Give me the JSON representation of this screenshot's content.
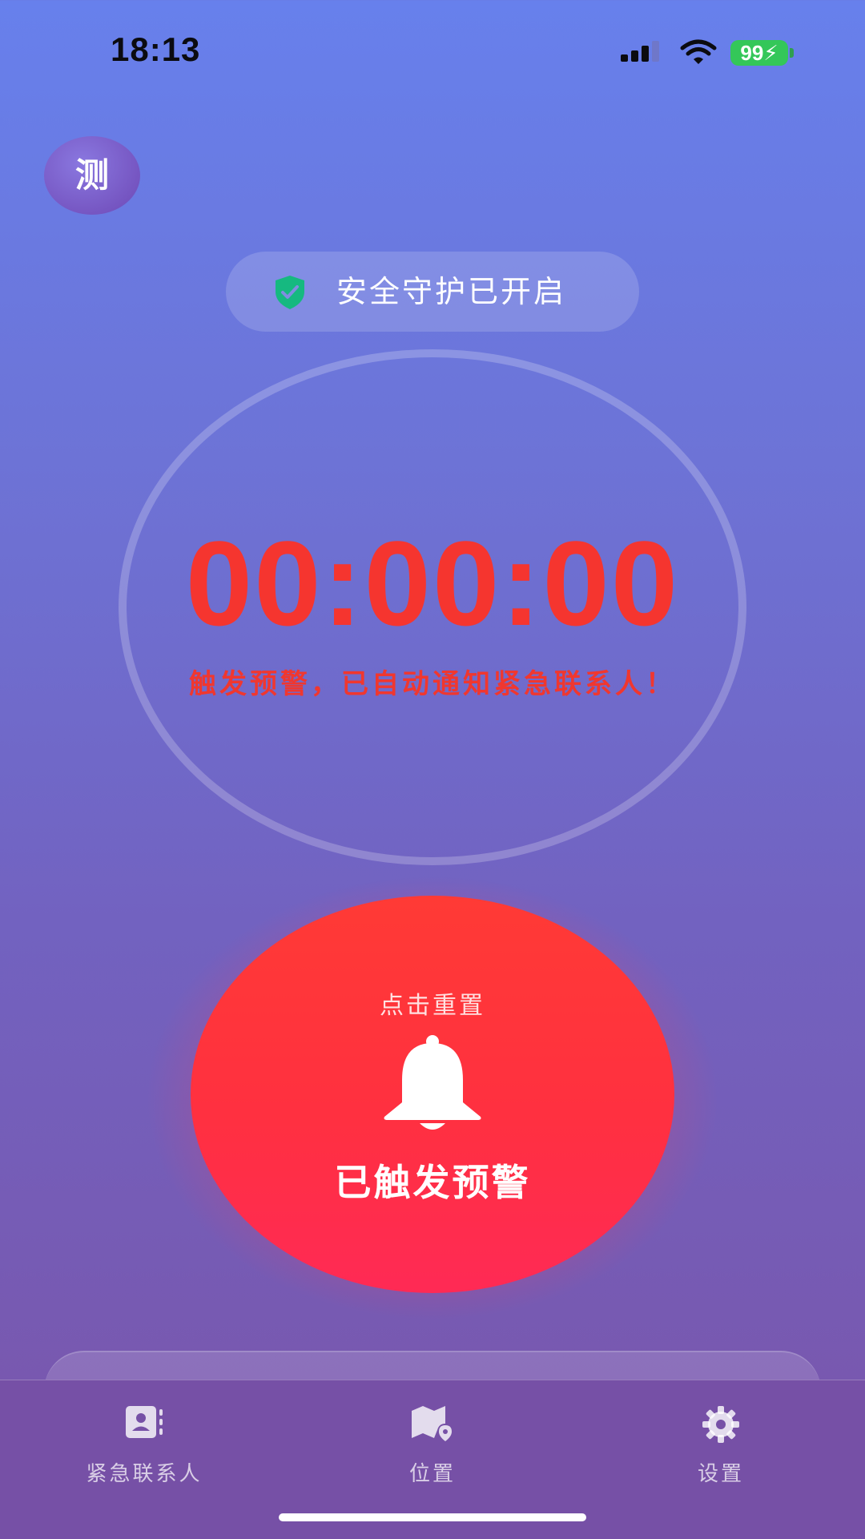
{
  "status_bar": {
    "time": "18:13",
    "battery": "99",
    "battery_color": "#34c759"
  },
  "avatar": {
    "initial": "测"
  },
  "protection": {
    "text": "安全守护已开启",
    "icon": "shield-check-icon",
    "icon_color": "#16b980"
  },
  "timer": {
    "value": "00:00:00",
    "message": "触发预警，已自动通知紧急联系人！",
    "color": "#f5352f"
  },
  "alarm": {
    "hint": "点击重置",
    "label": "已触发预警",
    "icon": "bell-icon",
    "color": "#ff3040"
  },
  "tab_bar": {
    "tabs": [
      {
        "label": "紧急联系人",
        "icon": "contacts-icon"
      },
      {
        "label": "位置",
        "icon": "map-location-icon"
      },
      {
        "label": "设置",
        "icon": "gear-icon"
      }
    ]
  }
}
